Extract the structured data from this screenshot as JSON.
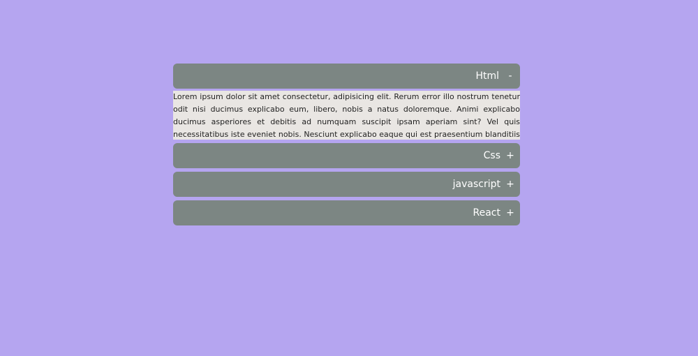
{
  "accordion": {
    "items": [
      {
        "title": "Html",
        "sign": "-",
        "body": "Lorem ipsum dolor sit amet consectetur, adipisicing elit. Rerum error illo nostrum tenetur odit nisi ducimus explicabo eum, libero, nobis a natus doloremque. Animi explicabo ducimus asperiores et debitis ad numquam suscipit ipsam aperiam sint? Vel quis necessitatibus iste eveniet nobis. Nesciunt explicabo eaque qui est praesentium blanditiis iure exercitationem."
      },
      {
        "title": "Css",
        "sign": "+"
      },
      {
        "title": "javascript",
        "sign": "+"
      },
      {
        "title": "React",
        "sign": "+"
      }
    ]
  },
  "colors": {
    "background": "#b5a5f0",
    "header": "#7c8683",
    "panel": "#e9e6e3"
  }
}
